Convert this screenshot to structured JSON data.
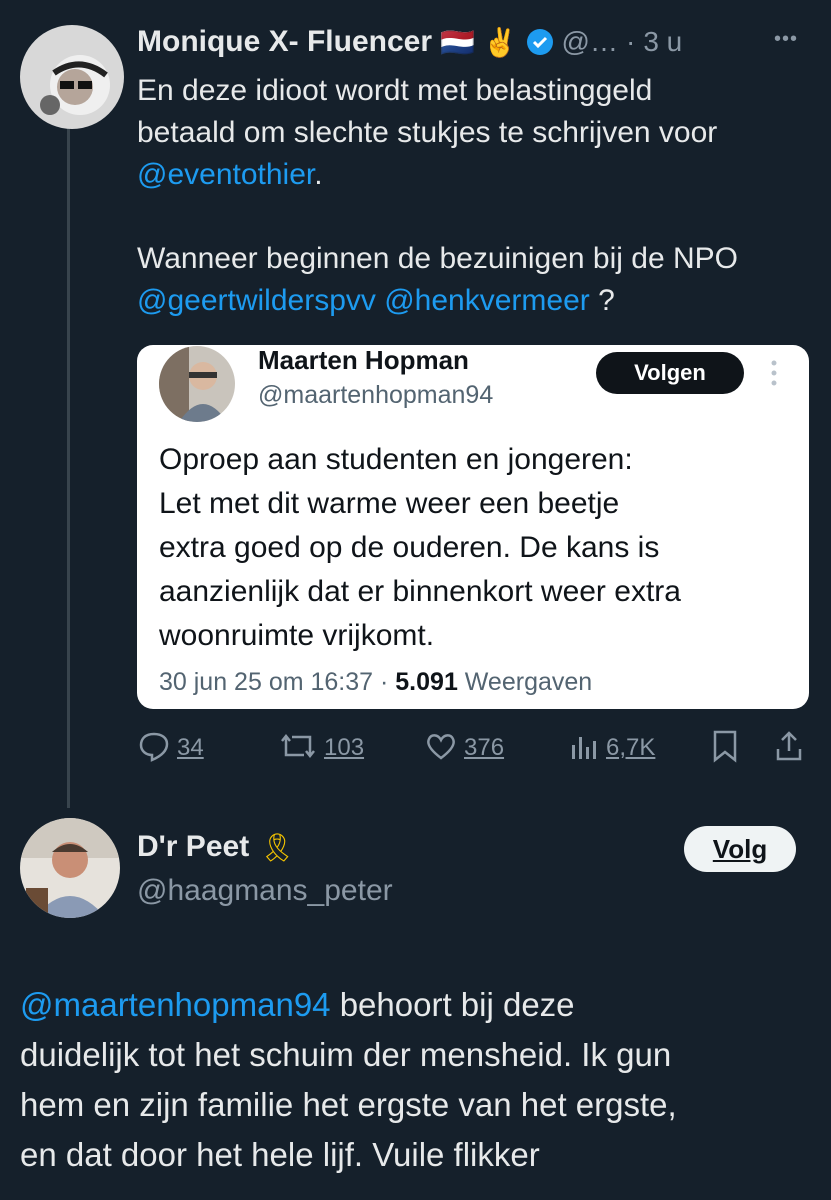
{
  "tweet": {
    "author_name": "Monique X- Fluencer",
    "author_emojis": "🇳🇱 ✌️",
    "handle": "@…",
    "separator": "·",
    "time": "3 u",
    "more": "•••",
    "text_line1": "En deze idioot wordt met belastinggeld",
    "text_line2": "betaald om slechte stukjes te schrijven voor",
    "mention1": "@eventothier",
    "punct1": ".",
    "text_line4": "Wanneer beginnen de bezuinigen bij de NPO",
    "mention2": "@geertwilderspvv",
    "mention3": "@henkvermeer",
    "punct2": " ?"
  },
  "quote": {
    "name": "Maarten Hopman",
    "handle": "@maartenhopman94",
    "follow_label": "Volgen",
    "line1": "Oproep aan studenten en jongeren:",
    "line2": "Let met dit warme weer een beetje",
    "line3": "extra goed op de ouderen. De kans is",
    "line4": "aanzienlijk dat er binnenkort weer extra",
    "line5": "woonruimte vrijkomt.",
    "date": "30 jun 25 om 16:37 · ",
    "views_count": "5.091",
    "views_label": " Weergaven"
  },
  "actions": {
    "replies": "34",
    "reposts": "103",
    "likes": "376",
    "views": "6,7K"
  },
  "reply": {
    "name": "D'r Peet",
    "ribbon": "🎗",
    "handle": "@haagmans_peter",
    "follow_label": "Volg",
    "mention": "@maartenhopman94",
    "line1_rest": " behoort bij deze",
    "line2": "duidelijk tot het schuim der mensheid. Ik gun",
    "line3": "hem en zijn familie het ergste van het ergste,",
    "line4": "en dat door het hele lijf. Vuile flikker"
  },
  "colors": {
    "background": "#15202b",
    "link": "#1d9bf0",
    "muted": "#8b98a5",
    "verified": "#1d9bf0"
  }
}
